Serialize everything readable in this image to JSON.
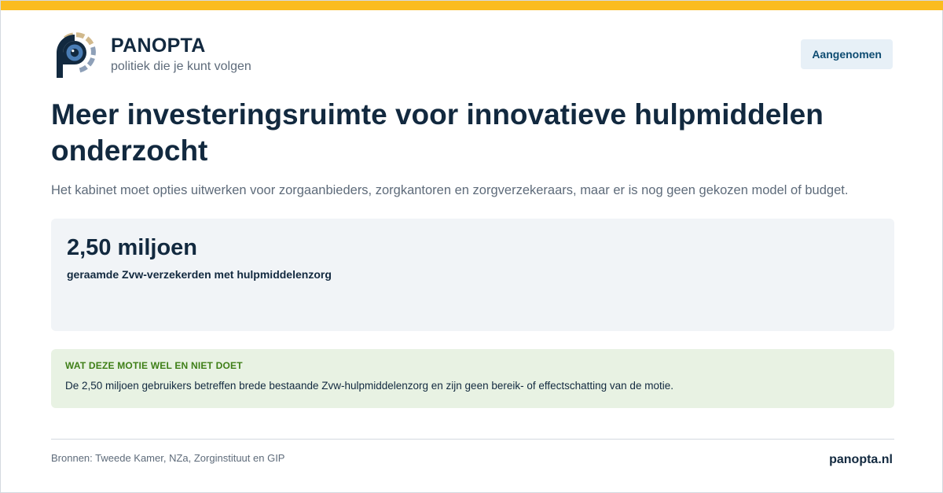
{
  "colors": {
    "accent_bar": "#fbbc1f",
    "brand_dark": "#12293f",
    "logo_segment_tan": "#d1b98c",
    "logo_segment_slate": "#8ea0b8",
    "logo_eye_blue": "#4a7db5",
    "logo_pupil": "#12293f"
  },
  "brand": {
    "logo_icon": "eye-p-logo-icon",
    "name": "PANOPTA",
    "tagline": "politiek die je kunt volgen"
  },
  "status": {
    "label": "Aangenomen"
  },
  "article": {
    "title": "Meer investeringsruimte voor innovatieve hulpmiddelen onderzocht",
    "subtitle": "Het kabinet moet opties uitwerken voor zorgaanbieders, zorgkantoren en zorgverzekeraars, maar er is nog geen gekozen model of budget."
  },
  "stat": {
    "value": "2,50 miljoen",
    "label": "geraamde Zvw-verzekerden met hulpmiddelenzorg"
  },
  "note": {
    "heading": "WAT DEZE MOTIE WEL EN NIET DOET",
    "text": "De 2,50 miljoen gebruikers betreffen brede bestaande Zvw-hulpmiddelenzorg en zijn geen bereik- of effectschatting van de motie."
  },
  "footer": {
    "sources": "Bronnen: Tweede Kamer, NZa, Zorginstituut en GIP",
    "site": "panopta.nl"
  }
}
